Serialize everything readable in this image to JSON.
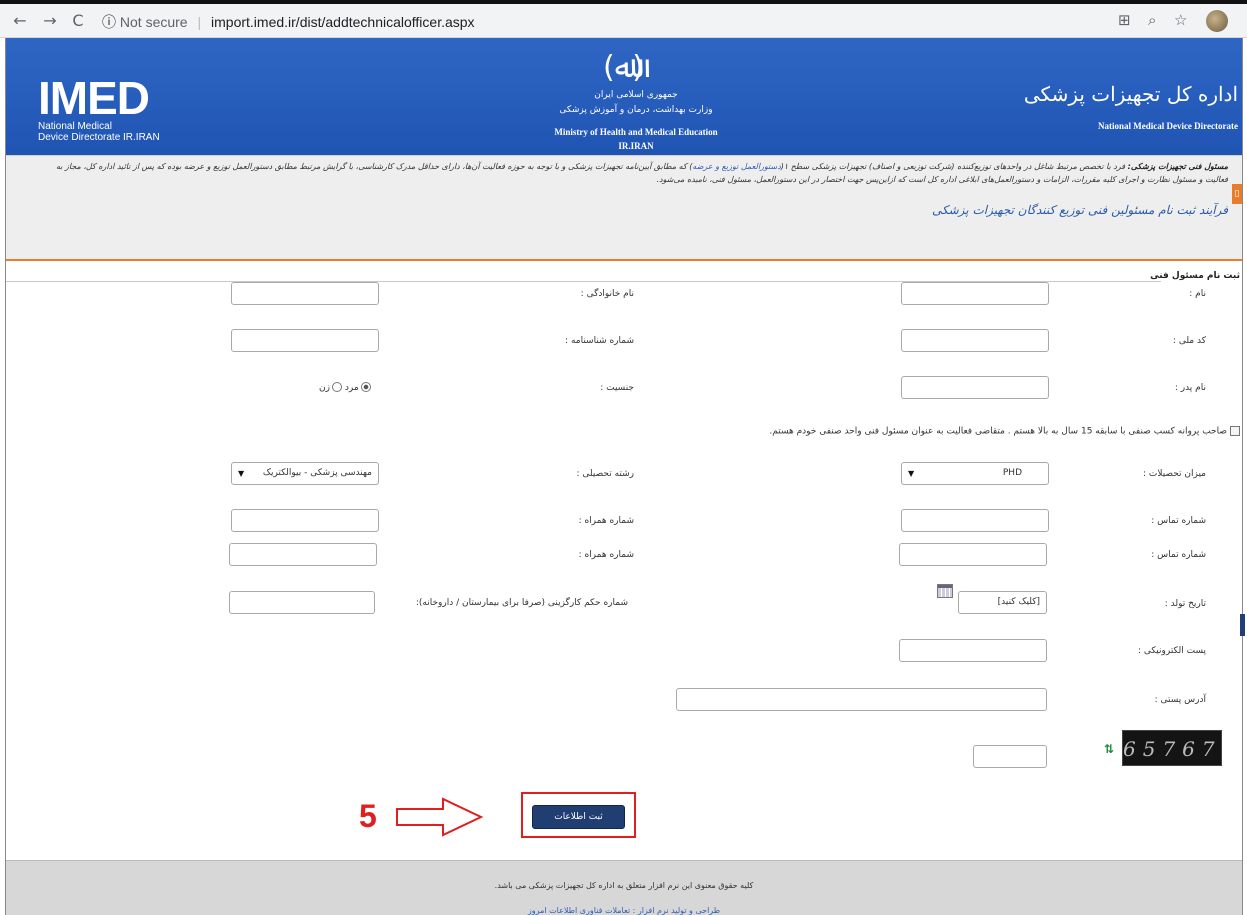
{
  "browser": {
    "security_label": "Not secure",
    "url": "import.imed.ir/dist/addtechnicalofficer.aspx"
  },
  "header": {
    "logo_text": "IMED",
    "logo_sub_1": "National Medical",
    "logo_sub_2": "Device Directorate IR.IRAN",
    "emblem": "(ﷲ)",
    "center_fa_1": "جمهوری اسلامی ایران",
    "center_fa_2": "وزارت بهداشت، درمان و آموزش پزشکی",
    "center_en_1": "Ministry of Health and Medical Education",
    "center_en_2": "IR.IRAN",
    "right_fa": "اداره کل تجهیزات پزشکی",
    "right_en": "National Medical Device Directorate"
  },
  "notice": {
    "bold_lead": "مسئول فنی تجهیزات پزشکی:",
    "line_1a": " فرد با تخصص مرتبط شاغل در واحدهای توزیع‌کننده (شرکت توزیعی و اصناف) تجهیزات پزشکی سطح ۱(",
    "link": "دستورالعمل توزیع و عرضه",
    "line_1b": ") که مطابق آیین‌نامه تجهیزات پزشکی و با توجه به حوزه فعالیت آن‌ها، دارای حداقل مدرک کارشناسی، با گرایش مرتبط مطابق دستورالعمل توزیع و عرضه بوده که پس از تائید اداره کل، مجاز به",
    "line_2": "فعالیت و مسئول نظارت و اجرای کلیه مقررات، الزامات و دستورالعمل‌های ابلاغی اداره کل است که ازاین‌پس جهت اختصار در این دستورالعمل، مسئول فنی، نامیده می‌شود.",
    "process_title": "فرآیند ثبت نام مسئولین فنی توزیع کنندگان تجهیزات پزشکی"
  },
  "form": {
    "section_title": "ثبت نام مسئول فنی",
    "first_name_label": "نام :",
    "last_name_label": "نام خانوادگی :",
    "national_code_label": "کد ملی :",
    "id_number_label": "شماره شناسنامه :",
    "father_name_label": "نام پدر :",
    "gender_label": "جنسیت :",
    "gender_male": "مرد",
    "gender_female": "زن",
    "license_checkbox_label": "صاحب پروانه کسب صنفی با سابقه 15 سال به بالا هستم . متقاضی فعالیت به عنوان مسئول فنی واحد صنفی خودم هستم.",
    "education_label": "میزان تحصیلات :",
    "education_value": "PHD",
    "field_label": "رشته تحصیلی :",
    "field_value": "مهندسی پزشکی - بیوالکتریک",
    "phone_label_1": "شماره تماس :",
    "mobile_label_1": "شماره همراه :",
    "phone_label_2": "شماره تماس :",
    "mobile_label_2": "شماره همراه :",
    "birth_date_label": "تاریخ تولد :",
    "birth_date_value": "[کلیک کنید]",
    "decree_label": "شماره حکم کارگزینی (صرفا برای بیمارستان / داروخانه):",
    "email_label": "پست الکترونیکی :",
    "address_label": "آدرس پستی :",
    "captcha_text": "65767",
    "submit_label": "ثبت اطلاعات"
  },
  "annotation": {
    "step_number": "5"
  },
  "footer": {
    "copyright": "کلیه حقوق معنوی این نرم افزار متعلق به اداره کل تجهیزات پزشکی می باشد.",
    "credits": "طراحی و تولید نرم افزار : تعاملات فناوری اطلاعات امروز"
  },
  "colors": {
    "banner_blue": "#2f66c4",
    "accent_orange": "#e87c2a",
    "submit_navy": "#203e72",
    "highlight_red": "#e01f1f"
  }
}
